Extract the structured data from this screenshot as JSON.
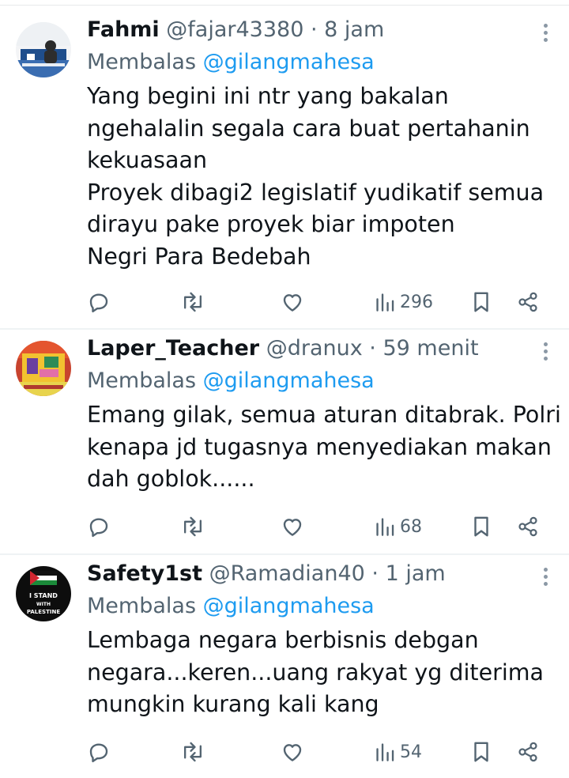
{
  "tweets": [
    {
      "name": "Fahmi",
      "handle": "@fajar43380",
      "dot": "·",
      "time": "8 jam",
      "reply_prefix": "Membalas",
      "reply_mention": "@gilangmahesa",
      "lines": [
        "Yang begini ini ntr yang bakalan",
        "ngehalalin segala cara buat pertahanin",
        "kekuasaan",
        "Proyek dibagi2 legislatif yudikatif semua",
        "dirayu pake proyek biar impoten",
        "Negri Para Bedebah"
      ],
      "views": "296"
    },
    {
      "name": "Laper_Teacher",
      "handle": "@dranux",
      "dot": "·",
      "time": "59 menit",
      "reply_prefix": "Membalas",
      "reply_mention": "@gilangmahesa",
      "lines": [
        "Emang gilak, semua aturan ditabrak. Polri",
        "kenapa jd tugasnya menyediakan makan",
        "dah goblok......"
      ],
      "views": "68"
    },
    {
      "name": "Safety1st",
      "handle": "@Ramadian40",
      "dot": "·",
      "time": "1 jam",
      "reply_prefix": "Membalas",
      "reply_mention": "@gilangmahesa",
      "lines": [
        "Lembaga negara berbisnis debgan",
        "negara...keren...uang rakyat yg diterima",
        "mungkin kurang kali kang"
      ],
      "views": "54",
      "avatar_text": [
        "I STAND",
        "WITH",
        "PALESTINE"
      ]
    }
  ],
  "icons": {
    "reply": "reply-icon",
    "retweet": "retweet-icon",
    "like": "like-icon",
    "views": "views-icon",
    "bookmark": "bookmark-icon",
    "share": "share-icon",
    "more": "more-icon"
  },
  "colors": {
    "text": "#0f1419",
    "secondary": "#536471",
    "link": "#1d9bf0",
    "divider": "#eff3f4"
  }
}
